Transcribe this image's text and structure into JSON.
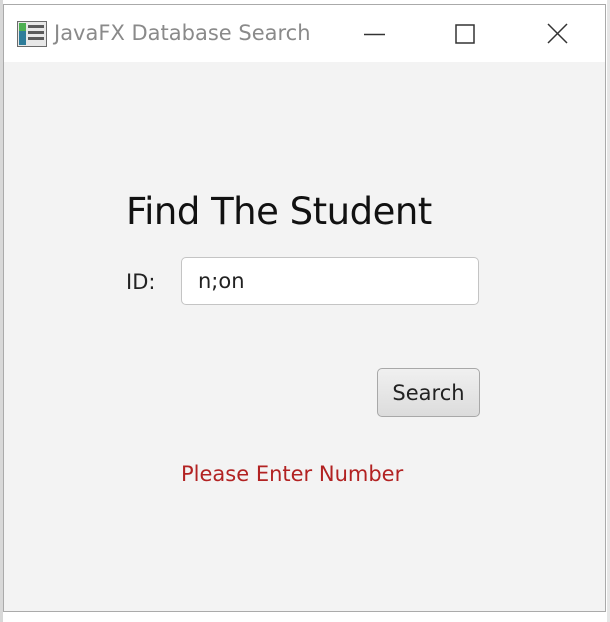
{
  "window": {
    "title": "JavaFX Database Search",
    "controls": {
      "minimize": "minimize-icon",
      "maximize": "maximize-icon",
      "close": "close-icon"
    }
  },
  "form": {
    "heading": "Find The Student",
    "id_label": "ID:",
    "id_value": "n;on",
    "search_label": "Search",
    "error_message": "Please Enter Number"
  },
  "colors": {
    "error": "#b22222",
    "window_bg": "#f3f3f3",
    "title_text": "#8a8a8a"
  }
}
